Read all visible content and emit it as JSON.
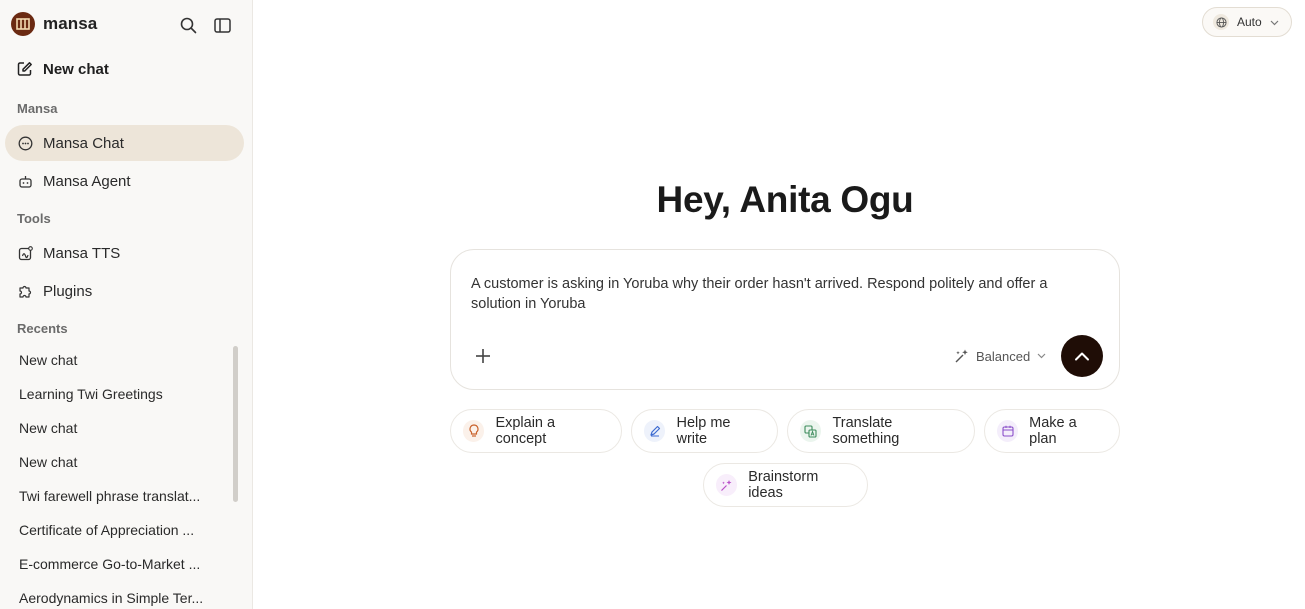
{
  "app": {
    "name": "mansa"
  },
  "sidebar": {
    "new_chat_label": "New chat",
    "sections": {
      "mansa": "Mansa",
      "tools": "Tools",
      "recents": "Recents"
    },
    "mansa_items": [
      {
        "label": "Mansa Chat",
        "icon": "chat-bubble-icon",
        "active": true
      },
      {
        "label": "Mansa Agent",
        "icon": "robot-icon",
        "active": false
      }
    ],
    "tool_items": [
      {
        "label": "Mansa TTS",
        "icon": "tts-icon"
      },
      {
        "label": "Plugins",
        "icon": "puzzle-icon"
      }
    ],
    "recents": [
      "New chat",
      "Learning Twi Greetings",
      "New chat",
      "New chat",
      "Twi farewell phrase translat...",
      "Certificate of Appreciation ...",
      "E-commerce Go-to-Market ...",
      "Aerodynamics in Simple Ter..."
    ]
  },
  "header": {
    "language_label": "Auto"
  },
  "main": {
    "greeting": "Hey, Anita Ogu",
    "composer": {
      "text": "A customer is asking in Yoruba why their order hasn't arrived. Respond politely and offer a solution in Yoruba",
      "mode_label": "Balanced"
    },
    "suggestions": [
      {
        "label": "Explain a concept",
        "icon": "lightbulb-icon",
        "color": "#c9622c"
      },
      {
        "label": "Help me write",
        "icon": "pen-icon",
        "color": "#3d6bd1"
      },
      {
        "label": "Translate something",
        "icon": "translate-icon",
        "color": "#3a8a5a"
      },
      {
        "label": "Make a plan",
        "icon": "calendar-icon",
        "color": "#8a4fc9"
      },
      {
        "label": "Brainstorm ideas",
        "icon": "sparkle-icon",
        "color": "#b94fc9"
      }
    ]
  },
  "colors": {
    "sidebar_bg": "#f9f8f6",
    "active_bg": "#ede5d9",
    "send_button": "#1f0d06",
    "logo": "#6b2a12"
  }
}
